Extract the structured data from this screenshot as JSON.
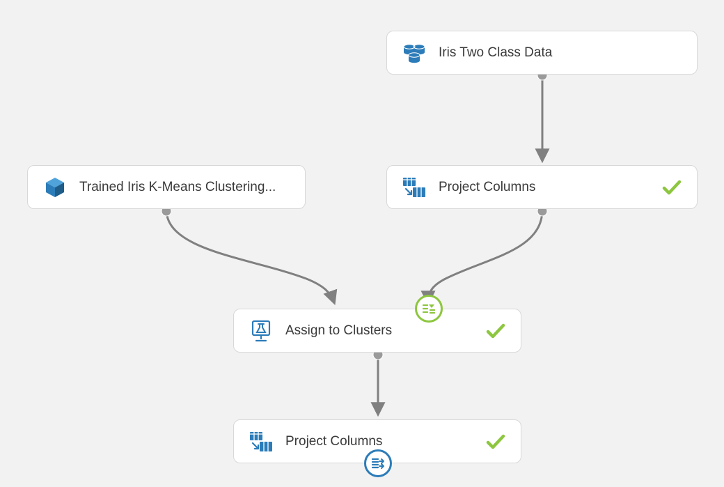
{
  "nodes": {
    "dataset": {
      "label": "Iris Two Class Data",
      "icon": "dataset"
    },
    "trained_model": {
      "label": "Trained Iris K-Means Clustering...",
      "icon": "trained-model"
    },
    "project_columns_1": {
      "label": "Project Columns",
      "icon": "project-columns",
      "status": "ok"
    },
    "assign_to_clusters": {
      "label": "Assign to Clusters",
      "icon": "experiment",
      "status": "ok"
    },
    "project_columns_2": {
      "label": "Project Columns",
      "icon": "project-columns",
      "status": "ok"
    }
  },
  "colors": {
    "azure_blue": "#2C7CB9",
    "success_green": "#8DC63F",
    "connector_gray": "#808080"
  }
}
